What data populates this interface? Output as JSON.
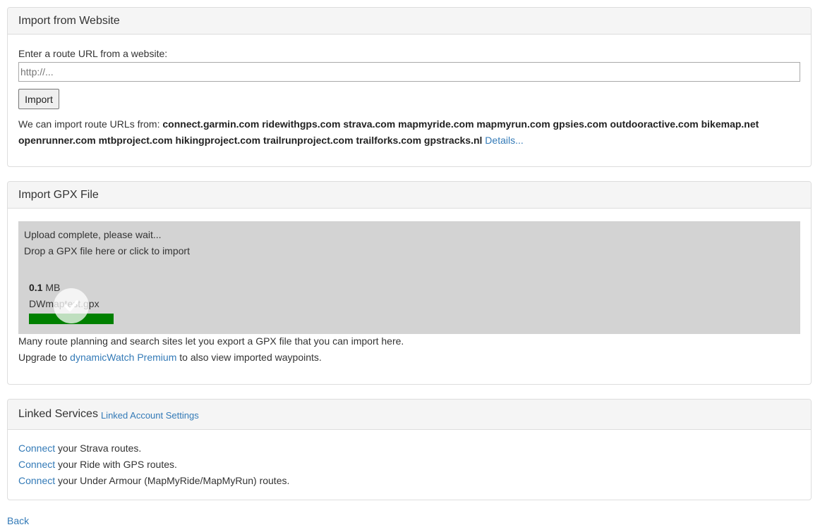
{
  "import_website": {
    "title": "Import from Website",
    "url_label": "Enter a route URL from a website:",
    "url_placeholder": "http://...",
    "import_button": "Import",
    "intro": "We can import route URLs from:",
    "sites": [
      "connect.garmin.com",
      "ridewithgps.com",
      "strava.com",
      "mapmyride.com",
      "mapmyrun.com",
      "gpsies.com",
      "outdooractive.com",
      "bikemap.net",
      "openrunner.com",
      "mtbproject.com",
      "hikingproject.com",
      "trailrunproject.com",
      "trailforks.com",
      "gpstracks.nl"
    ],
    "details_link": "Details..."
  },
  "import_gpx": {
    "title": "Import GPX File",
    "status": "Upload complete, please wait...",
    "drop_hint": "Drop a GPX file here or click to import",
    "file": {
      "size_value": "0.1",
      "size_unit": "MB",
      "name": "DWmaptest.gpx",
      "progress_percent": 100
    },
    "help_text": "Many route planning and search sites let you export a GPX file that you can import here.",
    "upgrade_prefix": "Upgrade to",
    "upgrade_link": "dynamicWatch Premium",
    "upgrade_suffix": "to also view imported waypoints."
  },
  "linked_services": {
    "title": "Linked Services",
    "settings_link": "Linked Account Settings",
    "items": [
      {
        "link": "Connect",
        "text": "your Strava routes."
      },
      {
        "link": "Connect",
        "text": "your Ride with GPS routes."
      },
      {
        "link": "Connect",
        "text": "your Under Armour (MapMyRide/MapMyRun) routes."
      }
    ]
  },
  "back_link": "Back",
  "colors": {
    "link": "#337ab7",
    "dropzone_bg": "#d3d3d3",
    "progress_fill": "#008000",
    "panel_heading_bg": "#f5f5f5"
  }
}
